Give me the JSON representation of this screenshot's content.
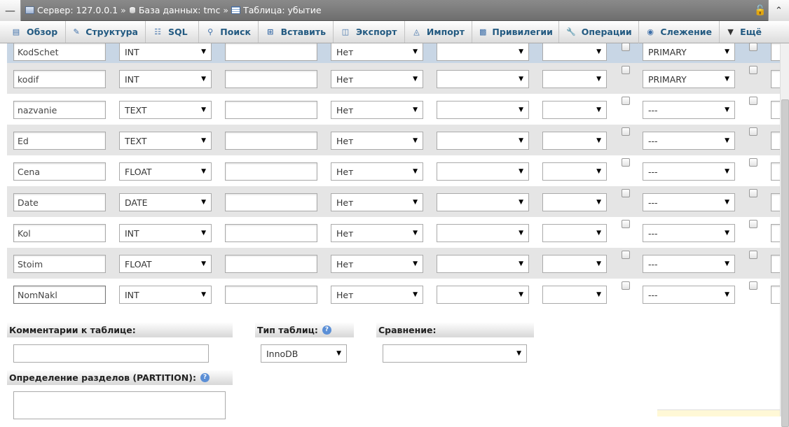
{
  "breadcrumb": {
    "server_label": "Сервер: 127.0.0.1",
    "db_label": "База данных: tmc",
    "table_label": "Таблица: убытие",
    "separator": "»"
  },
  "tabs": [
    {
      "label": "Обзор",
      "icon": "browse-icon"
    },
    {
      "label": "Структура",
      "icon": "structure-icon"
    },
    {
      "label": "SQL",
      "icon": "sql-icon"
    },
    {
      "label": "Поиск",
      "icon": "search-icon"
    },
    {
      "label": "Вставить",
      "icon": "insert-icon"
    },
    {
      "label": "Экспорт",
      "icon": "export-icon"
    },
    {
      "label": "Импорт",
      "icon": "import-icon"
    },
    {
      "label": "Привилегии",
      "icon": "privileges-icon"
    },
    {
      "label": "Операции",
      "icon": "wrench-icon"
    },
    {
      "label": "Слежение",
      "icon": "eye-icon"
    },
    {
      "label": "Ещё",
      "icon": "chevron-down-icon"
    }
  ],
  "fields": [
    {
      "name": "KodSchet",
      "type": "INT",
      "length": "",
      "default": "Нет",
      "collation": "",
      "attributes": "",
      "index": "PRIMARY"
    },
    {
      "name": "kodif",
      "type": "INT",
      "length": "",
      "default": "Нет",
      "collation": "",
      "attributes": "",
      "index": "PRIMARY"
    },
    {
      "name": "nazvanie",
      "type": "TEXT",
      "length": "",
      "default": "Нет",
      "collation": "",
      "attributes": "",
      "index": "---"
    },
    {
      "name": "Ed",
      "type": "TEXT",
      "length": "",
      "default": "Нет",
      "collation": "",
      "attributes": "",
      "index": "---"
    },
    {
      "name": "Cena",
      "type": "FLOAT",
      "length": "",
      "default": "Нет",
      "collation": "",
      "attributes": "",
      "index": "---"
    },
    {
      "name": "Date",
      "type": "DATE",
      "length": "",
      "default": "Нет",
      "collation": "",
      "attributes": "",
      "index": "---"
    },
    {
      "name": "Kol",
      "type": "INT",
      "length": "",
      "default": "Нет",
      "collation": "",
      "attributes": "",
      "index": "---"
    },
    {
      "name": "Stoim",
      "type": "FLOAT",
      "length": "",
      "default": "Нет",
      "collation": "",
      "attributes": "",
      "index": "---"
    },
    {
      "name": "NomNakl",
      "type": "INT",
      "length": "",
      "default": "Нет",
      "collation": "",
      "attributes": "",
      "index": "---"
    }
  ],
  "table_options": {
    "comment_label": "Комментарии к таблице:",
    "comment_value": "",
    "engine_label": "Тип таблиц:",
    "engine_value": "InnoDB",
    "collation_label": "Сравнение:",
    "collation_value": "",
    "partition_label": "Определение разделов (PARTITION):",
    "partition_value": ""
  }
}
